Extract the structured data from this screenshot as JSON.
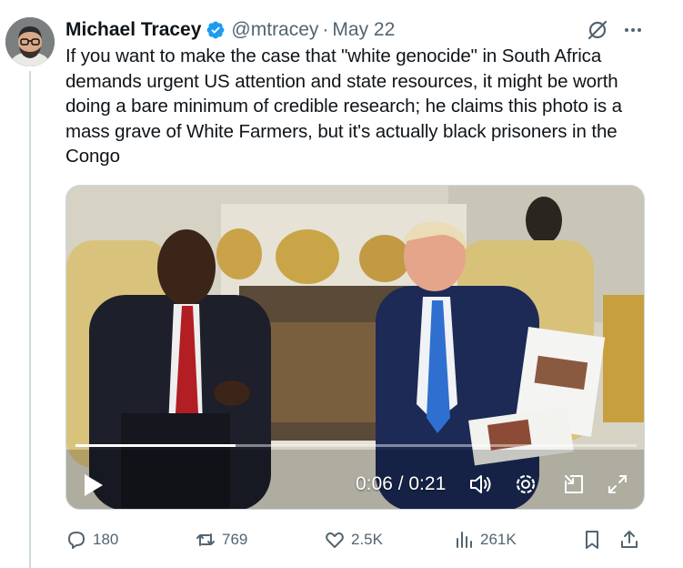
{
  "author": {
    "name": "Michael Tracey",
    "handle": "@mtracey",
    "separator": "·",
    "date": "May 22"
  },
  "tweet": {
    "text": "If you want to make the case that \"white genocide\" in South Africa demands urgent US attention and state resources, it might be worth doing a bare minimum of credible research; he claims this photo is a mass grave of White Farmers, but it's actually black prisoners in the Congo"
  },
  "video": {
    "time_display": "0:06 / 0:21",
    "progress": 0.2857
  },
  "actions": {
    "replies": "180",
    "reposts": "769",
    "likes": "2.5K",
    "views": "261K"
  },
  "colors": {
    "verified": "#1d9bf0",
    "text": "#0f1419",
    "secondary": "#536471"
  },
  "icons": [
    "verified-badge-icon",
    "grok-icon",
    "more-icon",
    "play-icon",
    "volume-icon",
    "settings-icon",
    "pip-icon",
    "fullscreen-icon",
    "reply-icon",
    "repost-icon",
    "like-icon",
    "views-icon",
    "bookmark-icon",
    "share-icon"
  ]
}
